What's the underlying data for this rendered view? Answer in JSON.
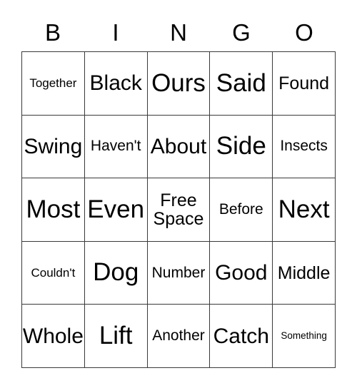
{
  "card": {
    "title_letters": [
      "B",
      "I",
      "N",
      "G",
      "O"
    ],
    "free_space_index": {
      "row": 2,
      "col": 2
    },
    "text_color": "#000000",
    "background_color": "#ffffff",
    "border_color": "#3a3a3a",
    "rows": [
      [
        {
          "label": "Together",
          "size": "fs-s"
        },
        {
          "label": "Black",
          "size": "fs-xl"
        },
        {
          "label": "Ours",
          "size": "fs-xxl"
        },
        {
          "label": "Said",
          "size": "fs-xxl"
        },
        {
          "label": "Found",
          "size": "fs-l"
        }
      ],
      [
        {
          "label": "Swing",
          "size": "fs-xl"
        },
        {
          "label": "Haven't",
          "size": "fs-m"
        },
        {
          "label": "About",
          "size": "fs-xl"
        },
        {
          "label": "Side",
          "size": "fs-xxl"
        },
        {
          "label": "Insects",
          "size": "fs-m"
        }
      ],
      [
        {
          "label": "Most",
          "size": "fs-xxl"
        },
        {
          "label": "Even",
          "size": "fs-xxl"
        },
        {
          "label": "Free\nSpace",
          "size": "fs-l"
        },
        {
          "label": "Before",
          "size": "fs-m"
        },
        {
          "label": "Next",
          "size": "fs-xxl"
        }
      ],
      [
        {
          "label": "Couldn't",
          "size": "fs-s"
        },
        {
          "label": "Dog",
          "size": "fs-xxl"
        },
        {
          "label": "Number",
          "size": "fs-m"
        },
        {
          "label": "Good",
          "size": "fs-xl"
        },
        {
          "label": "Middle",
          "size": "fs-l"
        }
      ],
      [
        {
          "label": "Whole",
          "size": "fs-xl"
        },
        {
          "label": "Lift",
          "size": "fs-xxl"
        },
        {
          "label": "Another",
          "size": "fs-m"
        },
        {
          "label": "Catch",
          "size": "fs-xl"
        },
        {
          "label": "Something",
          "size": "fs-xs"
        }
      ]
    ]
  }
}
